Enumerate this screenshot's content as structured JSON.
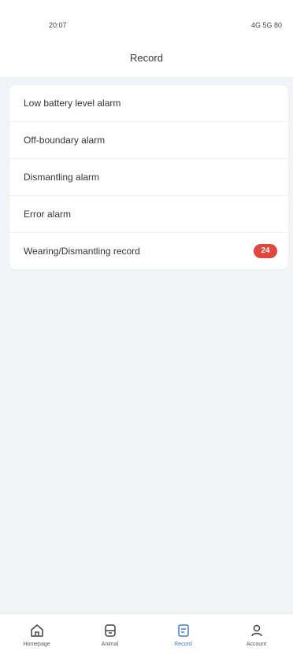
{
  "status": {
    "time": "20:07",
    "indicators": "4G 5G 80"
  },
  "header": {
    "title": "Record"
  },
  "list": [
    {
      "label": "Low battery level alarm",
      "badge": ""
    },
    {
      "label": "Off-boundary alarm",
      "badge": ""
    },
    {
      "label": "Dismantling alarm",
      "badge": ""
    },
    {
      "label": "Error alarm",
      "badge": ""
    },
    {
      "label": "Wearing/Dismantling record",
      "badge": "24",
      "badge_color": "#e2473b"
    }
  ],
  "tabbar": {
    "active_color": "#3b7ad9",
    "tabs": [
      {
        "label": "Homepage",
        "icon": "home-icon"
      },
      {
        "label": "Animal",
        "icon": "device-icon"
      },
      {
        "label": "Record",
        "icon": "record-icon",
        "active": true
      },
      {
        "label": "Account",
        "icon": "user-icon"
      }
    ]
  }
}
